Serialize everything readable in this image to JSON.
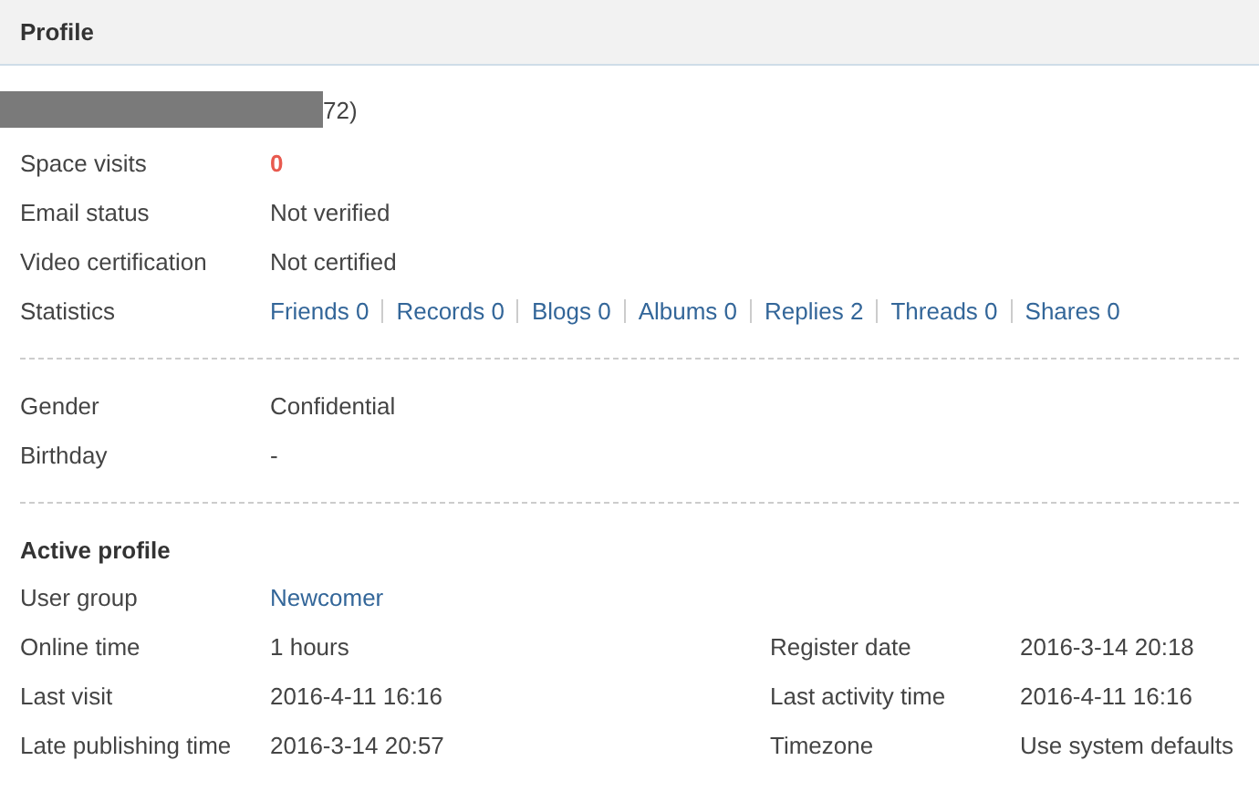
{
  "header": {
    "title": "Profile"
  },
  "username": {
    "redacted": true,
    "text": "72)"
  },
  "basic": [
    {
      "label": "Space visits",
      "value": "0",
      "kind": "alert"
    },
    {
      "label": "Email status",
      "value": "Not verified",
      "kind": "plain"
    },
    {
      "label": "Video certification",
      "value": "Not certified",
      "kind": "plain"
    }
  ],
  "statistics": {
    "label": "Statistics",
    "links": [
      "Friends 0",
      "Records 0",
      "Blogs 0",
      "Albums 0",
      "Replies 2",
      "Threads 0",
      "Shares 0"
    ]
  },
  "personal": [
    {
      "label": "Gender",
      "value": "Confidential",
      "kind": "plain"
    },
    {
      "label": "Birthday",
      "value": "-",
      "kind": "plain"
    }
  ],
  "active_profile": {
    "title": "Active profile",
    "rows": [
      {
        "left": {
          "label": "User group",
          "value": "Newcomer",
          "kind": "link"
        }
      },
      {
        "left": {
          "label": "Online time",
          "value": "1 hours",
          "kind": "plain"
        },
        "right": {
          "label": "Register date",
          "value": "2016-3-14 20:18",
          "kind": "plain"
        }
      },
      {
        "left": {
          "label": "Last visit",
          "value": "2016-4-11 16:16",
          "kind": "plain"
        },
        "right": {
          "label": "Last activity time",
          "value": "2016-4-11 16:16",
          "kind": "plain"
        }
      },
      {
        "left": {
          "label": "Late publishing time",
          "value": "2016-3-14 20:57",
          "kind": "plain"
        },
        "right": {
          "label": "Timezone",
          "value": "Use system defaults",
          "kind": "plain"
        }
      }
    ]
  }
}
